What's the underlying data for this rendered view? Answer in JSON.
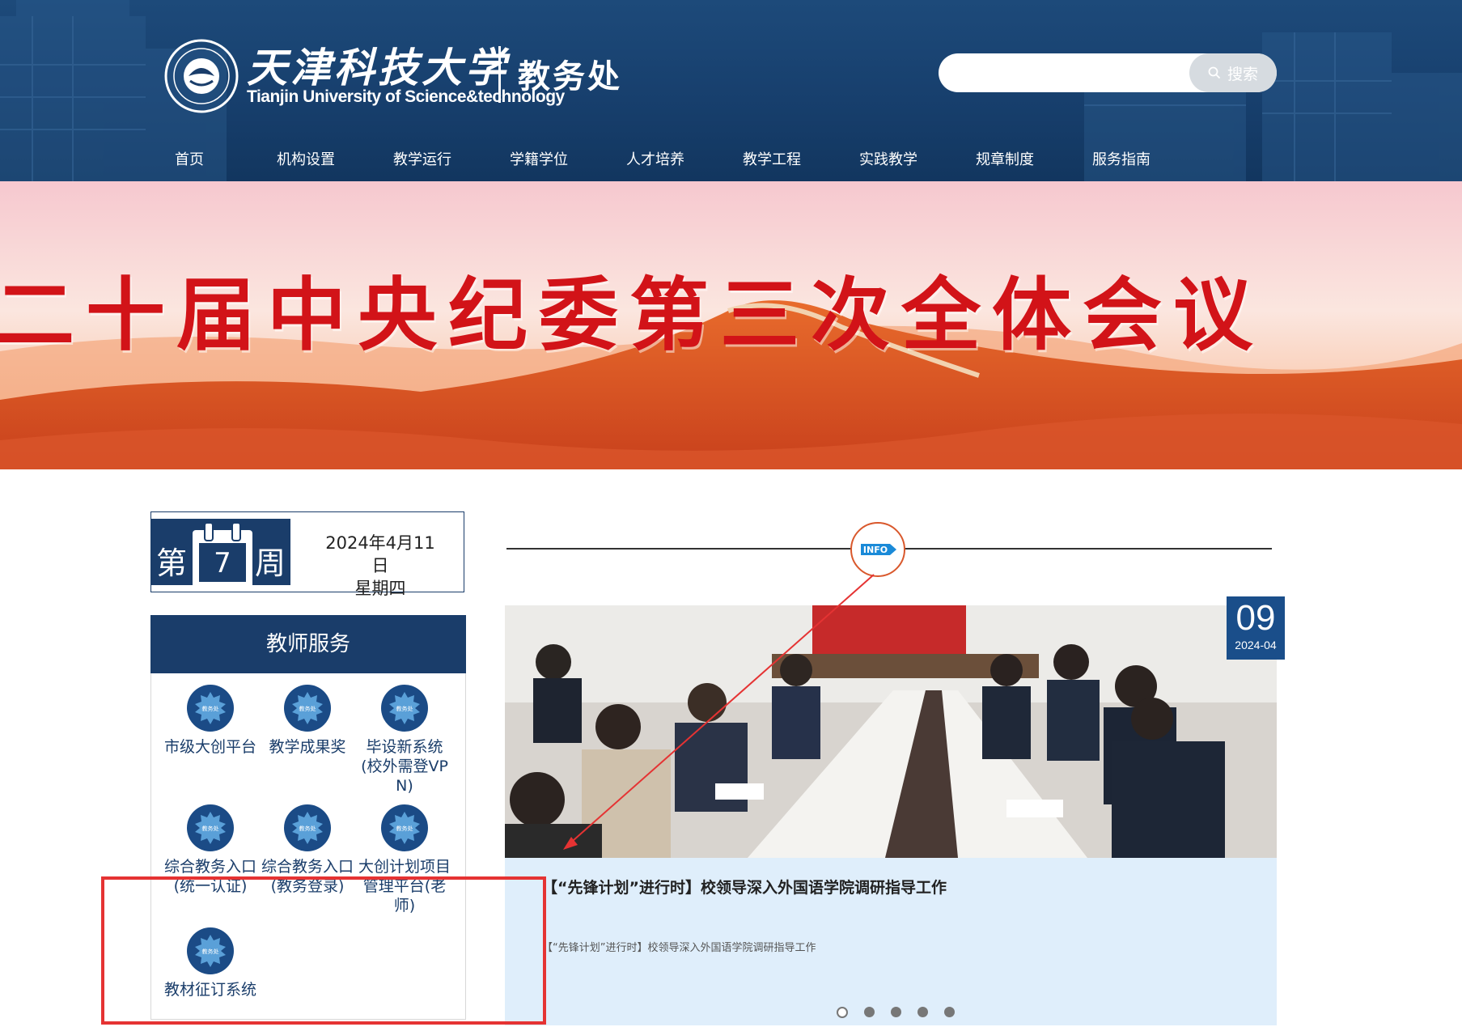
{
  "colors": {
    "primary": "#1a3d6a",
    "header": "#173f6d",
    "banner_text": "#d21318",
    "highlight": "#e53333",
    "news_bg": "#dfeefb"
  },
  "header": {
    "brand_cn": "天津科技大学",
    "brand_en": "Tianjin University of Science&technology",
    "dept": "教务处",
    "search": {
      "placeholder": "",
      "button_label": "搜索",
      "icon": "search-icon"
    }
  },
  "nav": {
    "items": [
      {
        "label": "首页"
      },
      {
        "label": "机构设置"
      },
      {
        "label": "教学运行"
      },
      {
        "label": "学籍学位"
      },
      {
        "label": "人才培养"
      },
      {
        "label": "教学工程"
      },
      {
        "label": "实践教学"
      },
      {
        "label": "规章制度"
      },
      {
        "label": "服务指南"
      }
    ]
  },
  "banner": {
    "title": "二十届中央纪委第三次全体会议"
  },
  "week": {
    "prefix": "第",
    "number": "7",
    "suffix": "周",
    "date": "2024年4月11日",
    "weekday": "星期四"
  },
  "teacher_service": {
    "title": "教师服务",
    "icon_text": "教务处",
    "items": [
      {
        "label": "市级大创平台"
      },
      {
        "label": "教学成果奖"
      },
      {
        "label": "毕设新系统(校外需登VPN)"
      },
      {
        "label": "综合教务入口(统一认证)"
      },
      {
        "label": "综合教务入口(教务登录)"
      },
      {
        "label": "大创计划项目管理平台(老师)"
      },
      {
        "label": "教材征订系统"
      }
    ]
  },
  "info": {
    "badge_text": "INFO"
  },
  "news": {
    "day": "09",
    "year_month": "2024-04",
    "title": "【“先锋计划”进行时】校领导深入外国语学院调研指导工作",
    "summary": "【“先锋计划”进行时】校领导深入外国语学院调研指导工作",
    "slide_count": 5,
    "active_slide": 1
  }
}
